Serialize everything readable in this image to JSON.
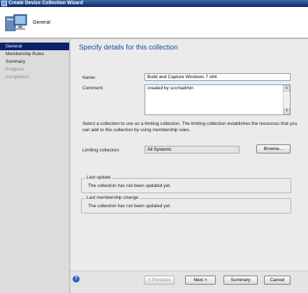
{
  "window": {
    "title": "Create Device Collection Wizard"
  },
  "header": {
    "title": "General"
  },
  "sidebar": {
    "steps": [
      {
        "label": "General",
        "state": "active"
      },
      {
        "label": "Membership Rules",
        "state": "enabled"
      },
      {
        "label": "Summary",
        "state": "enabled"
      },
      {
        "label": "Progress",
        "state": "disabled"
      },
      {
        "label": "Completion",
        "state": "disabled"
      }
    ]
  },
  "main": {
    "heading": "Specify details for this collection",
    "name_label": "Name:",
    "name_value": "Build and Capture Windows 7 x64",
    "comment_label": "Comment:",
    "comment_value": "created by sccmadmin",
    "limiting_info": "Select a collection to use as a limiting collection. The limiting collection establishes the resources that you can add to this collection by using membership rules.",
    "limiting_label": "Limiting collection:",
    "limiting_value": "All Systems",
    "browse_label": "Browse...",
    "last_update_legend": "Last update",
    "last_update_text": "The collection has not been updated yet.",
    "last_change_legend": "Last membership change",
    "last_change_text": "The collection has not been updated yet."
  },
  "footer": {
    "previous_label": "< Previous",
    "next_label": "Next >",
    "summary_label": "Summary",
    "cancel_label": "Cancel"
  },
  "colors": {
    "accent": "#1f4aa0",
    "titlebar": "#0a246a"
  }
}
